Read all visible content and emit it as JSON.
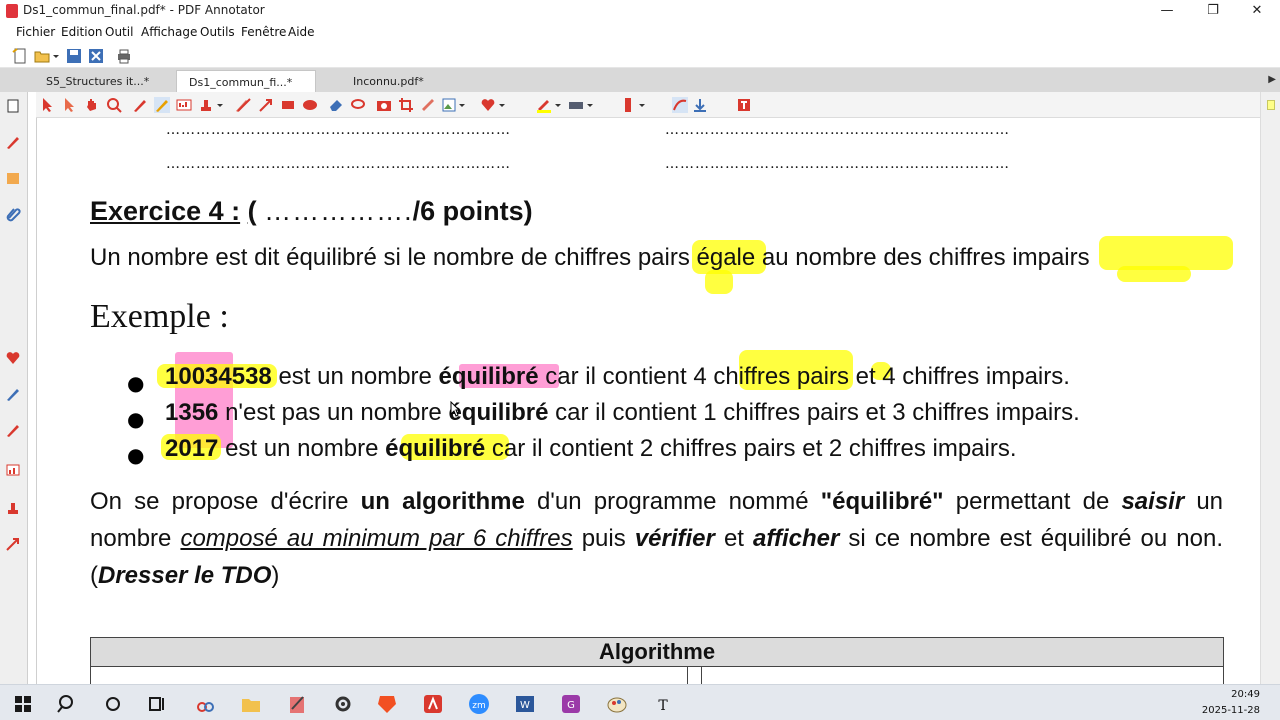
{
  "window": {
    "title": "Ds1_commun_final.pdf* - PDF Annotator",
    "minimize": "—",
    "maximize": "❐",
    "close": "✕"
  },
  "menu": [
    "Fichier",
    "Edition",
    "Outil",
    "Affichage",
    "Outils",
    "Fenêtre",
    "Aide"
  ],
  "tabs": [
    {
      "label": "S5_Structures it...*",
      "active": false
    },
    {
      "label": "Ds1_commun_fi...*",
      "active": true
    },
    {
      "label": "Inconnu.pdf*",
      "active": false
    }
  ],
  "tab_scroll": "▶",
  "document": {
    "dots_left": "……………………………………………………………",
    "dots_right": "……………………………………………………………",
    "exercise_label": "Exercice 4 :",
    "exercise_open": "(",
    "exercise_dots": "…………….",
    "exercise_points": "/6 points)",
    "sentence": "Un nombre est dit équilibré si le nombre de chiffres pairs égale au nombre des chiffres impairs",
    "example_heading": "Exemple :",
    "bullets": [
      {
        "number": "10034538",
        "pre": "est un nombre",
        "word": "équilibré",
        "post": "car il contient 4 chiffres pairs et 4 chiffres impairs."
      },
      {
        "number": "1356",
        "pre": "n'est pas un nombre",
        "word": "équilibré",
        "post": "car il contient 1 chiffres pairs et 3 chiffres impairs."
      },
      {
        "number": "2017",
        "pre": "est un nombre",
        "word": "équilibré",
        "post": "car il contient 2 chiffres pairs et 2 chiffres impairs."
      }
    ],
    "para": {
      "p1": "On se propose d'écrire",
      "b1": "un algorithme",
      "p2": "d'un programme nommé",
      "b2": "\"équilibré\"",
      "p3": "permettant de",
      "i1": "saisir",
      "p4": "un nombre",
      "u1": "composé au  minimum par 6 chiffres",
      "p5": "puis",
      "i2": "vérifier",
      "p6": "et",
      "i3": "afficher",
      "p7": "si ce nombre est équilibré ou non. (",
      "i4": "Dresser le TDO",
      "p8": ")"
    },
    "table_header": "Algorithme"
  },
  "colors": {
    "highlight_yellow": "#ffff00",
    "highlight_pink": "#ff4fb4",
    "accent_red": "#e0343c"
  },
  "clock": {
    "time": "20:49",
    "date": "2025-11-28"
  }
}
